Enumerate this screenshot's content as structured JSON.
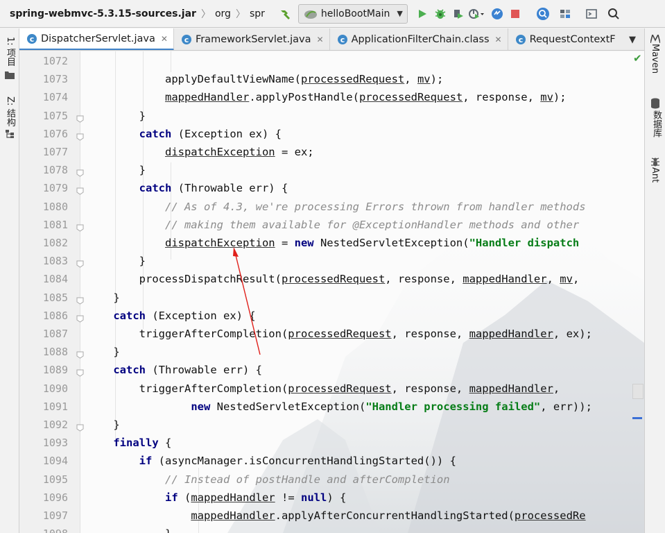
{
  "navbar": {
    "jar": "spring-webmvc-5.3.15-sources.jar",
    "crumb_org": "org",
    "crumb_spr": "spr",
    "run_config": "helloBootMain"
  },
  "left_strip": {
    "project": "1: 项目",
    "structure": "Z: 结构"
  },
  "right_strip": {
    "maven": "Maven",
    "database": "数据库",
    "ant": "Ant"
  },
  "tabs": [
    {
      "label": "DispatcherServlet.java",
      "active": true,
      "closable": true
    },
    {
      "label": "FrameworkServlet.java",
      "active": false,
      "closable": true
    },
    {
      "label": "ApplicationFilterChain.class",
      "active": false,
      "closable": true
    },
    {
      "label": "RequestContextF",
      "active": false,
      "closable": false
    }
  ],
  "editor": {
    "lines": [
      {
        "n": "1072",
        "segs": []
      },
      {
        "n": "1073",
        "segs": [
          {
            "t": "            "
          },
          {
            "t": "applyDefaultViewName("
          },
          {
            "t": "processedRequest",
            "c": "ul"
          },
          {
            "t": ", "
          },
          {
            "t": "mv",
            "c": "ul"
          },
          {
            "t": ");"
          }
        ]
      },
      {
        "n": "1074",
        "segs": [
          {
            "t": "            "
          },
          {
            "t": "mappedHandler",
            "c": "ul"
          },
          {
            "t": ".applyPostHandle("
          },
          {
            "t": "processedRequest",
            "c": "ul"
          },
          {
            "t": ", response, "
          },
          {
            "t": "mv",
            "c": "ul"
          },
          {
            "t": ");"
          }
        ]
      },
      {
        "n": "1075",
        "segs": [
          {
            "t": "        }"
          }
        ]
      },
      {
        "n": "1076",
        "segs": [
          {
            "t": "        "
          },
          {
            "t": "catch",
            "c": "kw"
          },
          {
            "t": " (Exception ex) {"
          }
        ]
      },
      {
        "n": "1077",
        "segs": [
          {
            "t": "            "
          },
          {
            "t": "dispatchException",
            "c": "ul"
          },
          {
            "t": " = ex;"
          }
        ]
      },
      {
        "n": "1078",
        "segs": [
          {
            "t": "        }"
          }
        ]
      },
      {
        "n": "1079",
        "segs": [
          {
            "t": "        "
          },
          {
            "t": "catch",
            "c": "kw"
          },
          {
            "t": " (Throwable err) {"
          }
        ]
      },
      {
        "n": "1080",
        "segs": [
          {
            "t": "            "
          },
          {
            "t": "// As of 4.3, we're processing Errors thrown from handler methods",
            "c": "cmt"
          }
        ]
      },
      {
        "n": "1081",
        "segs": [
          {
            "t": "            "
          },
          {
            "t": "// making them available for @ExceptionHandler methods and other",
            "c": "cmt"
          }
        ]
      },
      {
        "n": "1082",
        "segs": [
          {
            "t": "            "
          },
          {
            "t": "dispatchException",
            "c": "ul"
          },
          {
            "t": " = "
          },
          {
            "t": "new",
            "c": "kw"
          },
          {
            "t": " NestedServletException("
          },
          {
            "t": "\"Handler dispatch",
            "c": "str"
          }
        ]
      },
      {
        "n": "1083",
        "segs": [
          {
            "t": "        }"
          }
        ]
      },
      {
        "n": "1084",
        "segs": [
          {
            "t": "        "
          },
          {
            "t": "processDispatchResult("
          },
          {
            "t": "processedRequest",
            "c": "ul"
          },
          {
            "t": ", response, "
          },
          {
            "t": "mappedHandler",
            "c": "ul"
          },
          {
            "t": ", "
          },
          {
            "t": "mv",
            "c": "ul"
          },
          {
            "t": ","
          }
        ]
      },
      {
        "n": "1085",
        "segs": [
          {
            "t": "    }"
          }
        ]
      },
      {
        "n": "1086",
        "segs": [
          {
            "t": "    "
          },
          {
            "t": "catch",
            "c": "kw"
          },
          {
            "t": " (Exception ex) {"
          }
        ]
      },
      {
        "n": "1087",
        "segs": [
          {
            "t": "        "
          },
          {
            "t": "triggerAfterCompletion("
          },
          {
            "t": "processedRequest",
            "c": "ul"
          },
          {
            "t": ", response, "
          },
          {
            "t": "mappedHandler",
            "c": "ul"
          },
          {
            "t": ", ex);"
          }
        ]
      },
      {
        "n": "1088",
        "segs": [
          {
            "t": "    }"
          }
        ]
      },
      {
        "n": "1089",
        "segs": [
          {
            "t": "    "
          },
          {
            "t": "catch",
            "c": "kw"
          },
          {
            "t": " (Throwable err) {"
          }
        ]
      },
      {
        "n": "1090",
        "segs": [
          {
            "t": "        "
          },
          {
            "t": "triggerAfterCompletion("
          },
          {
            "t": "processedRequest",
            "c": "ul"
          },
          {
            "t": ", response, "
          },
          {
            "t": "mappedHandler",
            "c": "ul"
          },
          {
            "t": ","
          }
        ]
      },
      {
        "n": "1091",
        "segs": [
          {
            "t": "                "
          },
          {
            "t": "new",
            "c": "kw"
          },
          {
            "t": " NestedServletException("
          },
          {
            "t": "\"Handler processing failed\"",
            "c": "str"
          },
          {
            "t": ", err));"
          }
        ]
      },
      {
        "n": "1092",
        "segs": [
          {
            "t": "    }"
          }
        ]
      },
      {
        "n": "1093",
        "segs": [
          {
            "t": "    "
          },
          {
            "t": "finally",
            "c": "kw"
          },
          {
            "t": " {"
          }
        ]
      },
      {
        "n": "1094",
        "segs": [
          {
            "t": "        "
          },
          {
            "t": "if",
            "c": "kw"
          },
          {
            "t": " (asyncManager.isConcurrentHandlingStarted()) {"
          }
        ]
      },
      {
        "n": "1095",
        "segs": [
          {
            "t": "            "
          },
          {
            "t": "// Instead of postHandle and afterCompletion",
            "c": "cmt"
          }
        ]
      },
      {
        "n": "1096",
        "segs": [
          {
            "t": "            "
          },
          {
            "t": "if",
            "c": "kw"
          },
          {
            "t": " ("
          },
          {
            "t": "mappedHandler",
            "c": "ul"
          },
          {
            "t": " != "
          },
          {
            "t": "null",
            "c": "kw"
          },
          {
            "t": ") {"
          }
        ]
      },
      {
        "n": "1097",
        "segs": [
          {
            "t": "                "
          },
          {
            "t": "mappedHandler",
            "c": "ul"
          },
          {
            "t": ".applyAfterConcurrentHandlingStarted("
          },
          {
            "t": "processedRe",
            "c": "ul"
          }
        ]
      },
      {
        "n": "1098",
        "segs": [
          {
            "t": "            }"
          }
        ]
      }
    ]
  },
  "colors": {
    "keyword": "#000080",
    "string": "#067d17",
    "comment": "#8c8c8c",
    "annotation_arrow": "#e0201b",
    "active_tab_underline": "#4083c9"
  },
  "icons": [
    "hammer-icon",
    "run-icon",
    "debug-icon",
    "coverage-icon",
    "profile-icon",
    "update-icon",
    "stop-icon",
    "search-everywhere-icon",
    "project-structure-icon",
    "tool-window-icon",
    "search-icon"
  ]
}
